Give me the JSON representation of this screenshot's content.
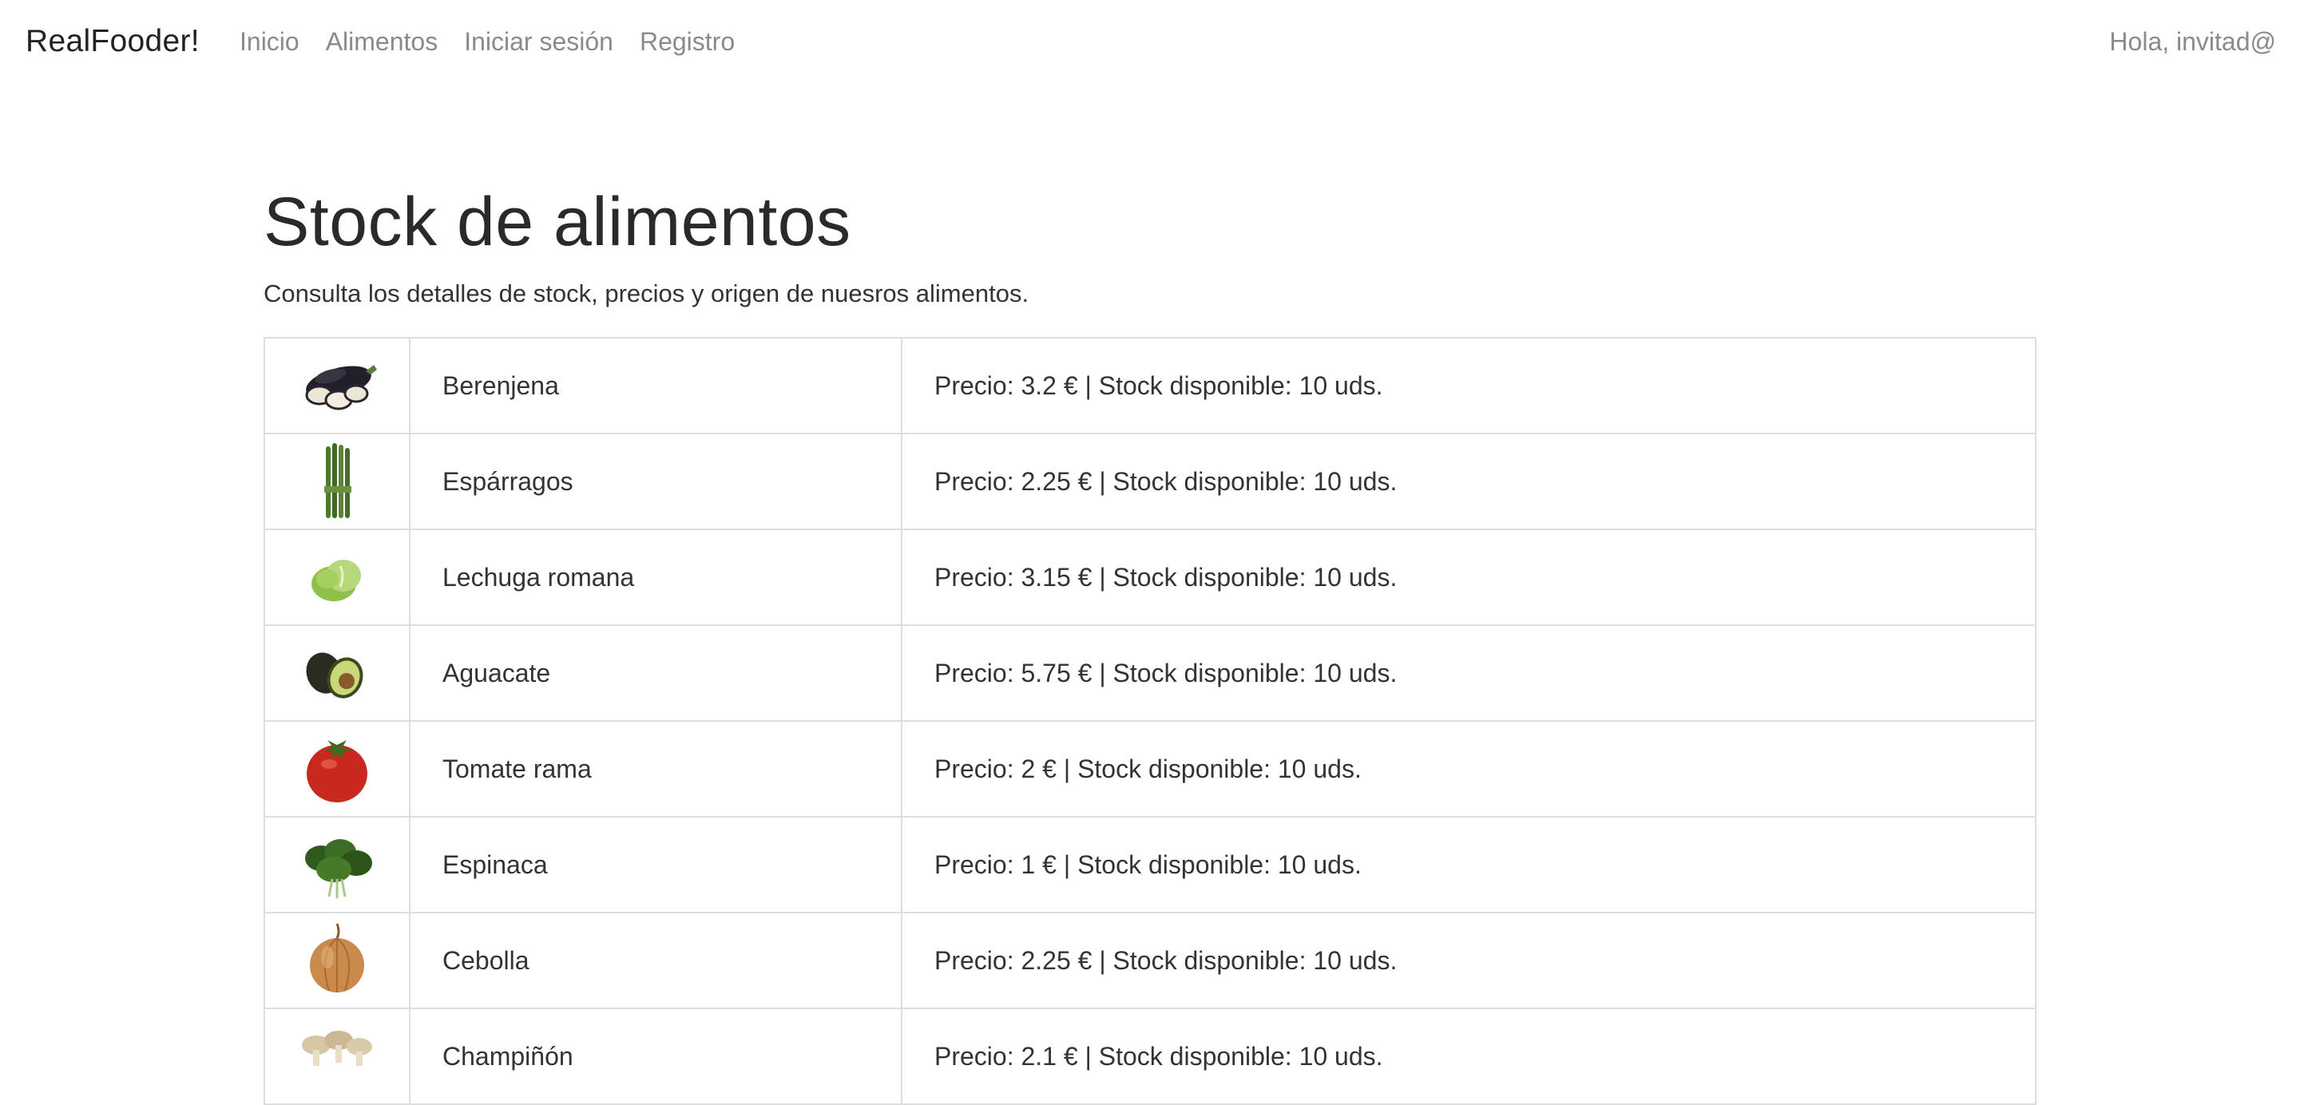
{
  "navbar": {
    "brand": "RealFooder!",
    "links": [
      "Inicio",
      "Alimentos",
      "Iniciar sesión",
      "Registro"
    ],
    "greeting": "Hola, invitad@"
  },
  "main": {
    "title": "Stock de alimentos",
    "subtitle": "Consulta los detalles de stock, precios y origen de nuesros alimentos."
  },
  "foods": [
    {
      "name": "Berenjena",
      "details": "Precio: 3.2 € | Stock disponible: 10 uds.",
      "image": "eggplant"
    },
    {
      "name": "Espárragos",
      "details": "Precio: 2.25 € | Stock disponible: 10 uds.",
      "image": "asparagus"
    },
    {
      "name": "Lechuga romana",
      "details": "Precio: 3.15 € | Stock disponible: 10 uds.",
      "image": "lettuce"
    },
    {
      "name": "Aguacate",
      "details": "Precio: 5.75 € | Stock disponible: 10 uds.",
      "image": "avocado"
    },
    {
      "name": "Tomate rama",
      "details": "Precio: 2 € | Stock disponible: 10 uds.",
      "image": "tomato"
    },
    {
      "name": "Espinaca",
      "details": "Precio: 1 € | Stock disponible: 10 uds.",
      "image": "spinach"
    },
    {
      "name": "Cebolla",
      "details": "Precio: 2.25 € | Stock disponible: 10 uds.",
      "image": "onion"
    },
    {
      "name": "Champiñón",
      "details": "Precio: 2.1 € | Stock disponible: 10 uds.",
      "image": "mushroom"
    }
  ]
}
